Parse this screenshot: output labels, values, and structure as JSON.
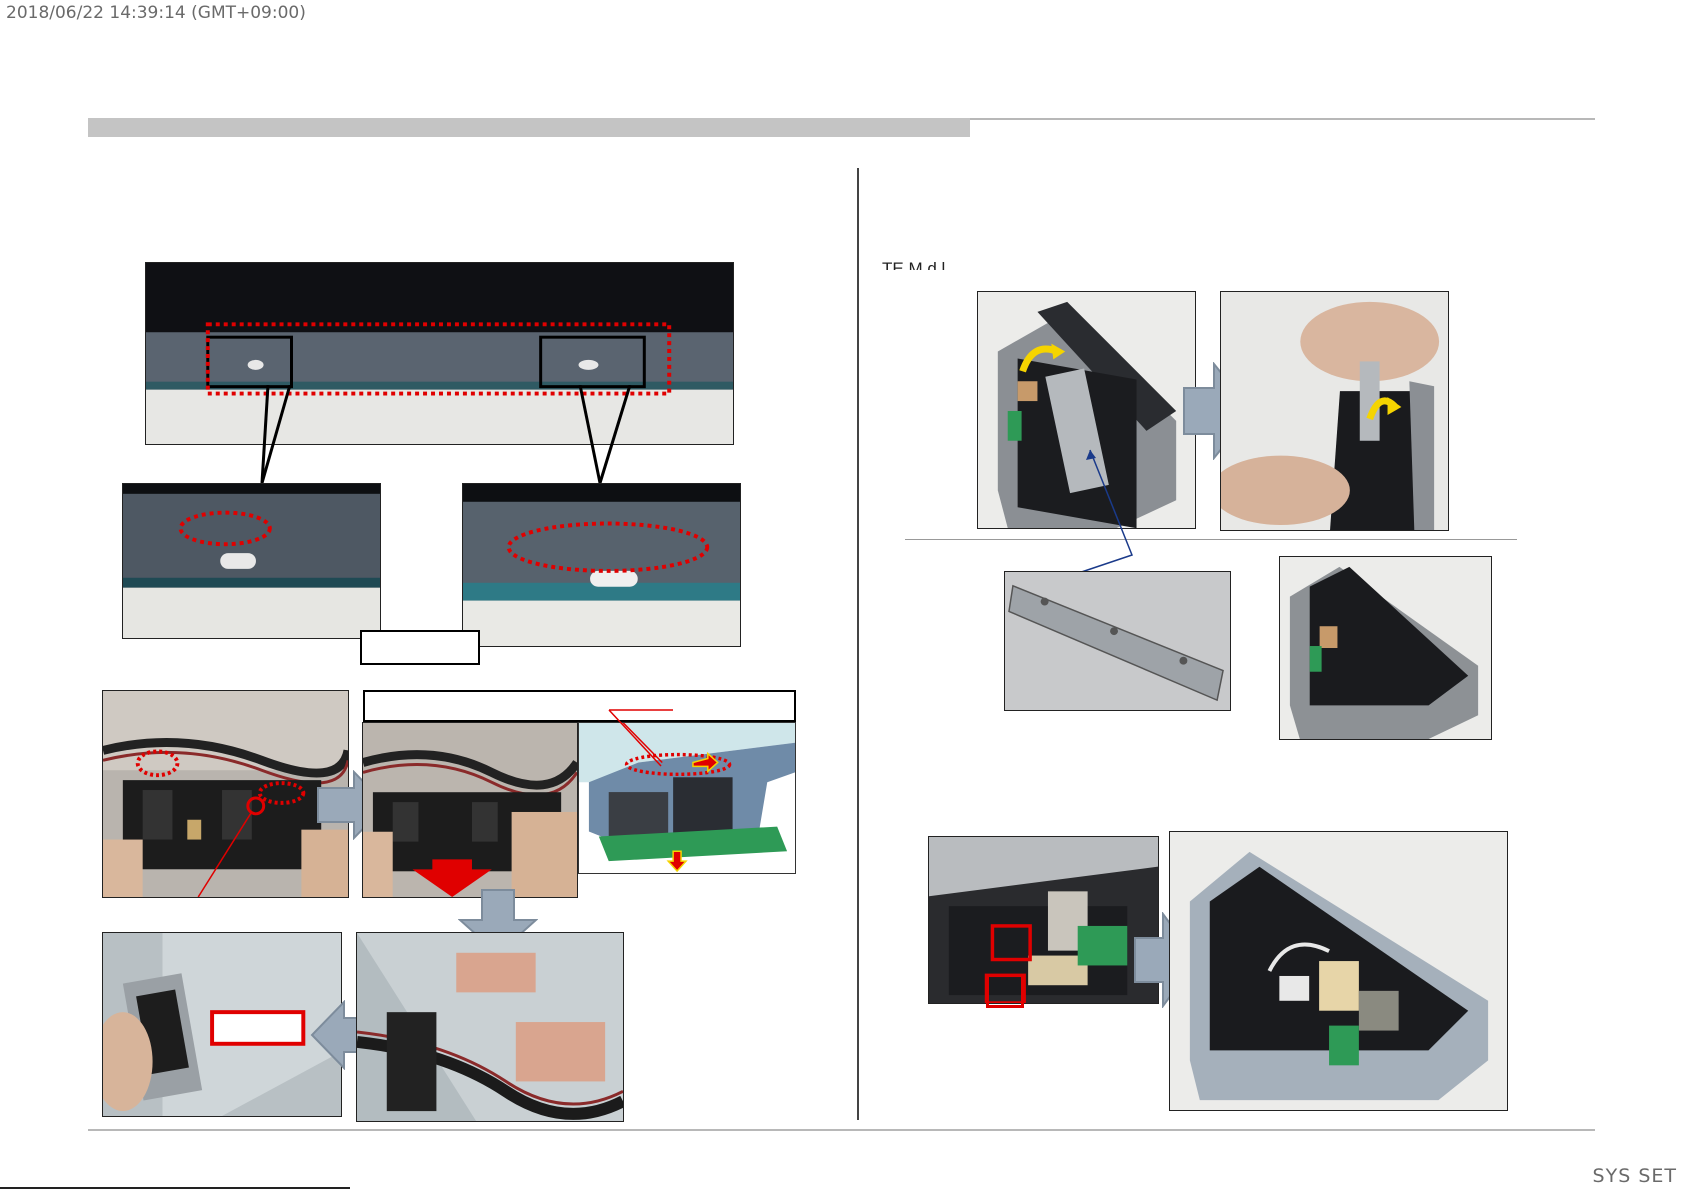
{
  "header": {
    "timestamp": "2018/06/22 14:39:14 (GMT+09:00)"
  },
  "right_panel": {
    "heading_fragment": "TE M d l"
  },
  "footer": {
    "label": "SYS SET"
  },
  "colors": {
    "title_bar": "#c4c4c4",
    "rule": "#b8b8b8",
    "highlight_red": "#e00000",
    "arrow_fill": "#9aa9b9",
    "arrow_stroke": "#7d8c9c",
    "yellow_arrow": "#f5d400"
  }
}
